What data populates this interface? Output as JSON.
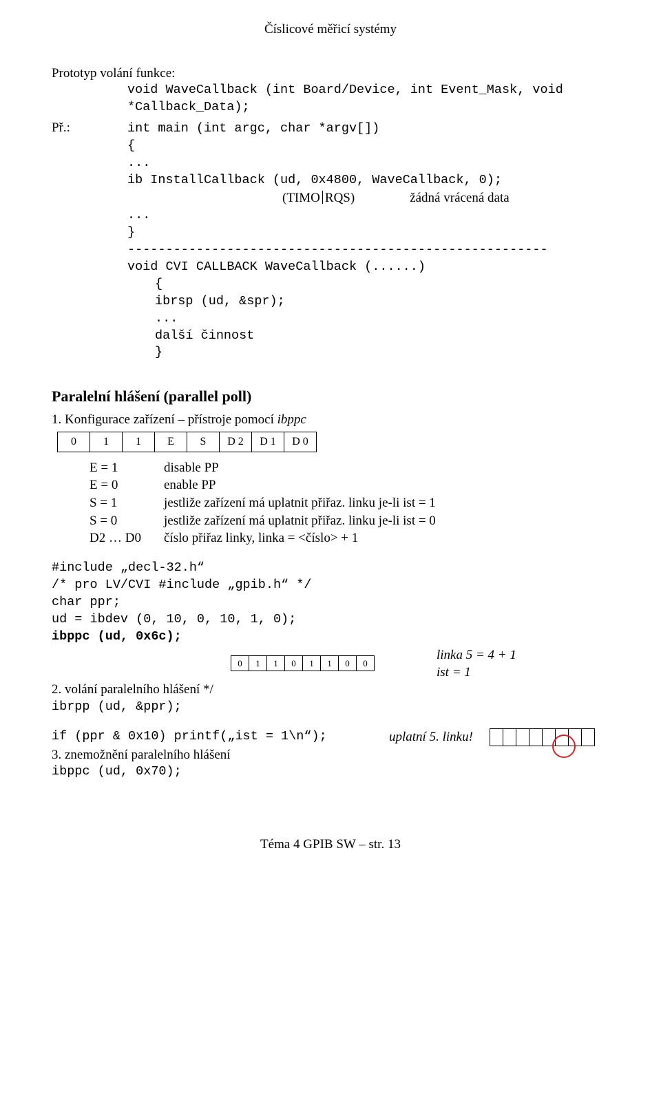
{
  "header": "Číslicové měřicí systémy",
  "proto": {
    "label": "Prototyp volání funkce:",
    "line1": "void WaveCallback (int Board/Device, int Event_Mask, void",
    "line2": "*Callback_Data);"
  },
  "pr": {
    "label": "Př.:",
    "l1": "int main (int argc, char *argv[])",
    "l2": "{",
    "l3": "...",
    "l4": "ib InstallCallback (ud, 0x4800, WaveCallback, 0);",
    "paren_left": "(TIMO",
    "paren_right": "RQS)",
    "paren_after": "žádná vrácená data",
    "l5": "...",
    "l6": "}",
    "dashes": "-------------------------------------------------------",
    "l7": "void CVI CALLBACK WaveCallback (......)",
    "l8": "{",
    "l9": "ibrsp (ud, &spr);",
    "l10": "...",
    "l11": "další činnost",
    "l12": "}"
  },
  "pp": {
    "heading": "Paralelní hlášení (parallel poll)",
    "step1_a": "1. Konfigurace zařízení – přístroje pomocí ",
    "step1_b": "ibppc",
    "bits1": [
      "0",
      "1",
      "1",
      "E",
      "S",
      "D 2",
      "D 1",
      "D 0"
    ],
    "eq": [
      {
        "l": "E = 1",
        "r": "disable PP"
      },
      {
        "l": "E = 0",
        "r": "enable PP"
      },
      {
        "l": "S = 1",
        "r": "jestliže zařízení má uplatnit přiřaz. linku je-li ist = 1"
      },
      {
        "l": "S = 0",
        "r": "jestliže zařízení má uplatnit přiřaz. linku je-li ist = 0"
      },
      {
        "l": "D2 … D0",
        "r": "číslo přiřaz linky, linka = <číslo> + 1"
      }
    ],
    "code1": "#include „decl-32.h“",
    "code2": "/* pro LV/CVI #include „gpib.h“ */",
    "code3": "char ppr;",
    "code4": "ud = ibdev (0, 10, 0, 10, 1, 0);",
    "code5": "ibppc (ud, 0x6c);",
    "bits2": [
      "0",
      "1",
      "1",
      "0",
      "1",
      "1",
      "0",
      "0"
    ],
    "rhs1": "linka 5 = 4 + 1",
    "rhs2": "ist = 1",
    "step2": "2. volání paralelního hlášení */",
    "code6": "ibrpp (ud, &ppr);",
    "code7": "if (ppr & 0x10) printf(„ist = 1\\n“);",
    "note7": "uplatní 5. linku!",
    "step3": "3. znemožnění paralelního hlášení",
    "code8": "ibppc (ud, 0x70);"
  },
  "footer": "Téma 4 GPIB SW – str. 13"
}
